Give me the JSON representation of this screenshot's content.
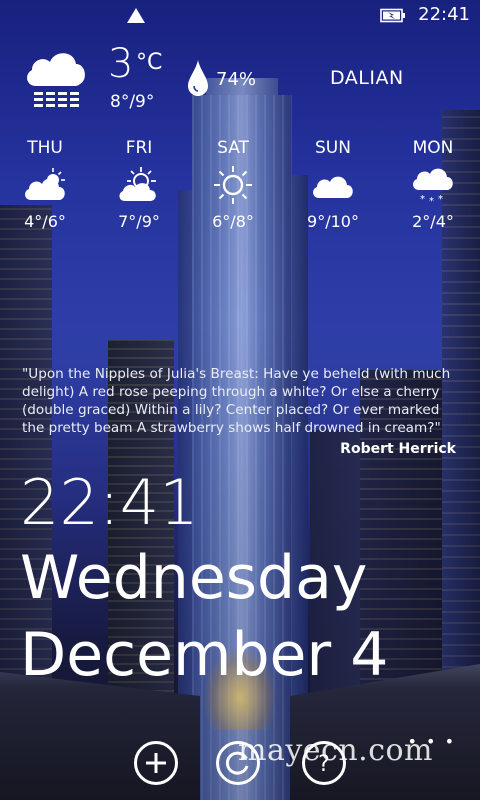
{
  "status_bar": {
    "time": "22:41",
    "icons": [
      "signal-icon",
      "battery-charging-icon"
    ]
  },
  "current": {
    "icon": "cloud-rain-icon",
    "temperature": "3",
    "unit": "°C",
    "range": "8°/9°",
    "humidity_icon": "water-drop-icon",
    "humidity": "74%",
    "city": "DALIAN"
  },
  "forecast": [
    {
      "day": "THU",
      "icon": "sun-behind-cloud-icon",
      "range": "4°/6°"
    },
    {
      "day": "FRI",
      "icon": "sun-behind-cloud-icon",
      "range": "7°/9°"
    },
    {
      "day": "SAT",
      "icon": "sun-icon",
      "range": "6°/8°"
    },
    {
      "day": "SUN",
      "icon": "cloud-icon",
      "range": "9°/10°"
    },
    {
      "day": "MON",
      "icon": "cloud-snow-icon",
      "range": "2°/4°"
    }
  ],
  "quote": {
    "text": "\"Upon the Nipples of Julia's Breast: Have ye beheld (with much delight) A red rose peeping through a white? Or else a cherry (double graced) Within a lily? Center placed? Or ever marked the pretty beam A strawberry shows half drowned in cream?\"",
    "author": "Robert Herrick"
  },
  "clock": {
    "time": "22:41",
    "weekday": "Wednesday",
    "date": "December 4"
  },
  "app_bar": {
    "buttons": [
      "add-icon",
      "refresh-icon",
      "help-icon"
    ],
    "more": "• • •"
  },
  "watermark": "mayecn.com",
  "colors": {
    "text": "#ffffff",
    "sky": "#2735a6"
  }
}
